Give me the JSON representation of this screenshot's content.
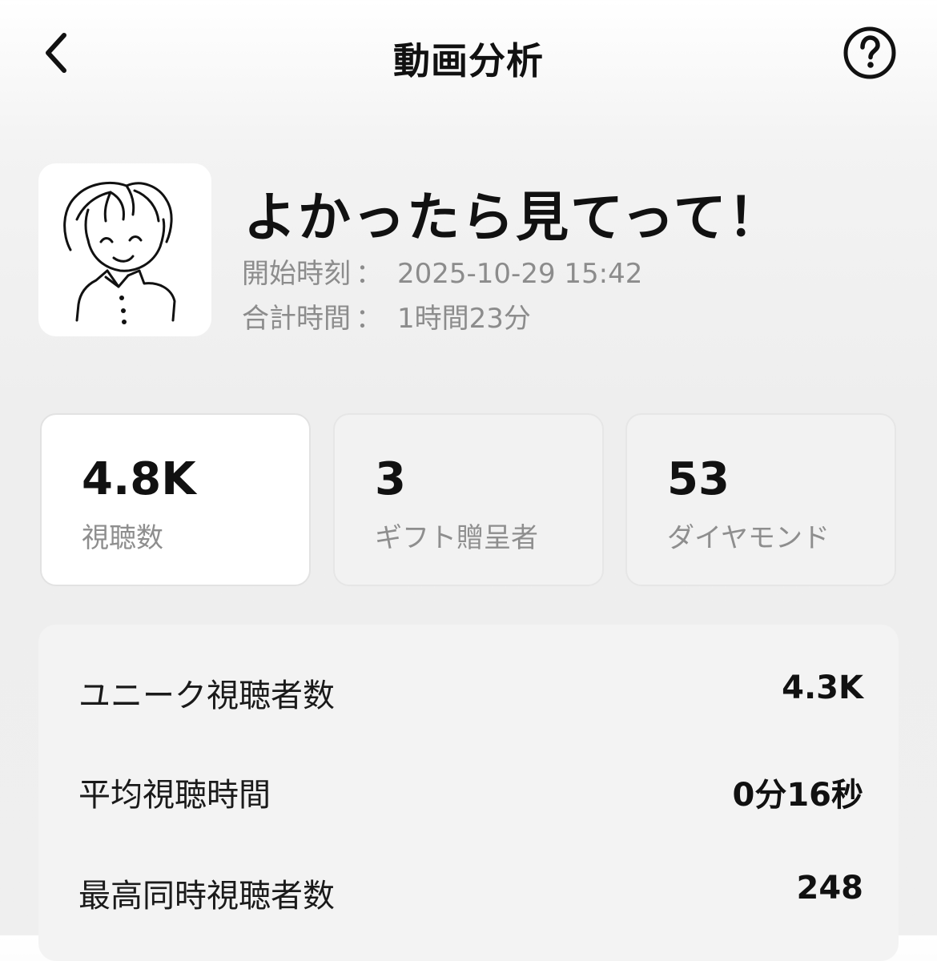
{
  "header": {
    "title": "動画分析",
    "back_icon": "chevron-left-icon",
    "help_icon": "question-circle-icon"
  },
  "video": {
    "title": "よかったら見てって！",
    "thumbnail_icon": "hand-drawn-avatar",
    "start_label": "開始時刻",
    "start_value": "2025-10-29 15:42",
    "total_label": "合計時間",
    "total_value": "1時間23分",
    "separator": "："
  },
  "stats": [
    {
      "value": "4.8K",
      "label": "視聴数",
      "active": true
    },
    {
      "value": "3",
      "label": "ギフト贈呈者",
      "active": false
    },
    {
      "value": "53",
      "label": "ダイヤモンド",
      "active": false
    }
  ],
  "metrics": [
    {
      "label": "ユニーク視聴者数",
      "value": "4.3K"
    },
    {
      "label": "平均視聴時間",
      "value": "0分16秒"
    },
    {
      "label": "最高同時視聴者数",
      "value": "248"
    }
  ]
}
